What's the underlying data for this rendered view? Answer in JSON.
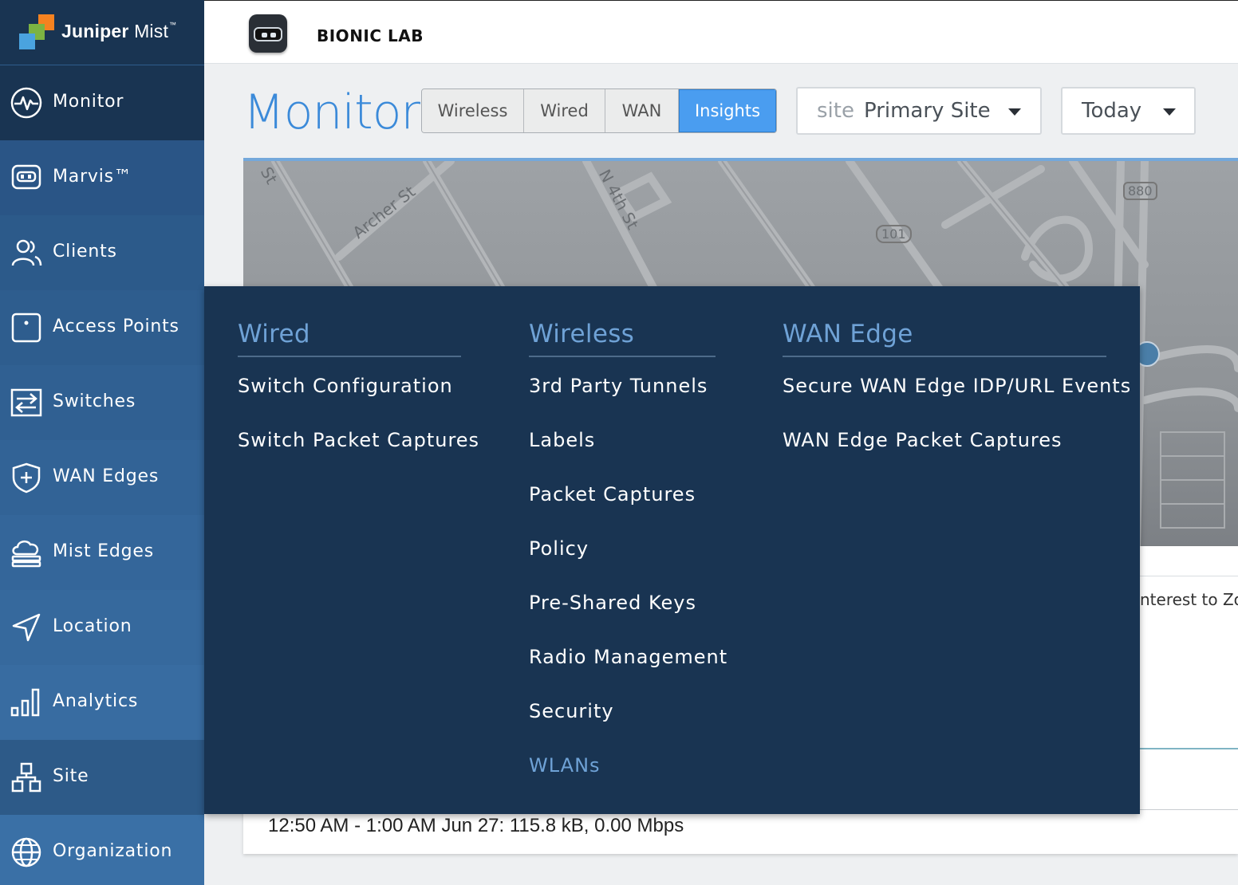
{
  "brand": {
    "name_bold": "Juniper",
    "name_light": "Mist",
    "tm": "™"
  },
  "org": {
    "name": "BIONIC LAB"
  },
  "sidebar": {
    "items": [
      {
        "label": "Monitor",
        "icon": "monitor-pulse-icon"
      },
      {
        "label": "Marvis™",
        "icon": "marvis-icon"
      },
      {
        "label": "Clients",
        "icon": "users-icon"
      },
      {
        "label": "Access Points",
        "icon": "access-point-icon"
      },
      {
        "label": "Switches",
        "icon": "switch-icon"
      },
      {
        "label": "WAN Edges",
        "icon": "wan-edge-shield-icon"
      },
      {
        "label": "Mist Edges",
        "icon": "mist-edge-cloud-icon"
      },
      {
        "label": "Location",
        "icon": "location-arrow-icon"
      },
      {
        "label": "Analytics",
        "icon": "analytics-bars-icon"
      },
      {
        "label": "Site",
        "icon": "site-hierarchy-icon"
      },
      {
        "label": "Organization",
        "icon": "globe-icon"
      }
    ]
  },
  "monitor": {
    "title": "Monitor",
    "tabs": [
      {
        "label": "Wireless",
        "active": false
      },
      {
        "label": "Wired",
        "active": false
      },
      {
        "label": "WAN",
        "active": false
      },
      {
        "label": "Insights",
        "active": true
      }
    ],
    "site_select": {
      "prefix": "site",
      "value": "Primary Site"
    },
    "time_select": {
      "value": "Today"
    }
  },
  "map": {
    "labels": [
      "St",
      "Archer St",
      "N 4th St",
      "101",
      "880"
    ]
  },
  "content": {
    "zoom_hint": "nterest to Zoo",
    "tooltip": "12:50 AM - 1:00 AM Jun 27: 115.8 kB, 0.00 Mbps"
  },
  "menu": {
    "columns": [
      {
        "heading": "Wired",
        "items": [
          "Switch Configuration",
          "Switch Packet Captures"
        ]
      },
      {
        "heading": "Wireless",
        "items": [
          "3rd Party Tunnels",
          "Labels",
          "Packet Captures",
          "Policy",
          "Pre-Shared Keys",
          "Radio Management",
          "Security",
          "WLANs"
        ]
      },
      {
        "heading": "WAN Edge",
        "items": [
          "Secure WAN Edge IDP/URL Events",
          "WAN Edge Packet Captures"
        ]
      }
    ],
    "highlighted_item": "WLANs"
  },
  "colors": {
    "sidebar_bg": "#2e5c8c",
    "logo_bg": "#193452",
    "menu_bg": "#193452",
    "accent": "#3b8ad9",
    "active_tab": "#4a9df0"
  }
}
